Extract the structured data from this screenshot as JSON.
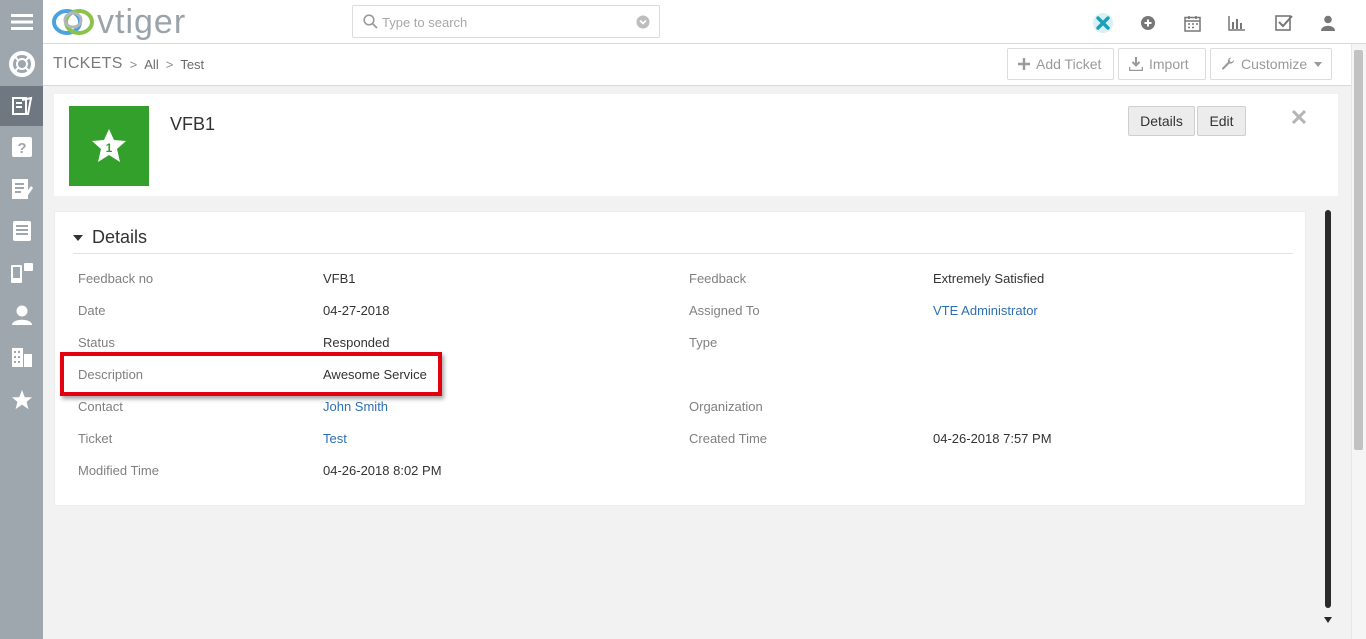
{
  "app": {
    "logo_text": "vtiger",
    "search_placeholder": "Type to search"
  },
  "breadcrumb": {
    "module": "TICKETS",
    "items": [
      "All",
      "Test"
    ]
  },
  "toolbar": {
    "add_label": "Add Ticket",
    "import_label": "Import",
    "customize_label": "Customize"
  },
  "record": {
    "title": "VFB1",
    "details_btn": "Details",
    "edit_btn": "Edit"
  },
  "section": {
    "title": "Details"
  },
  "fields": {
    "feedback_no": {
      "label": "Feedback no",
      "value": "VFB1"
    },
    "date": {
      "label": "Date",
      "value": "04-27-2018"
    },
    "status": {
      "label": "Status",
      "value": "Responded"
    },
    "description": {
      "label": "Description",
      "value": "Awesome Service"
    },
    "contact": {
      "label": "Contact",
      "value": "John Smith"
    },
    "ticket": {
      "label": "Ticket",
      "value": "Test"
    },
    "modified_time": {
      "label": "Modified Time",
      "value": "04-26-2018 8:02 PM"
    },
    "feedback": {
      "label": "Feedback",
      "value": "Extremely Satisfied"
    },
    "assigned_to": {
      "label": "Assigned To",
      "value": "VTE Administrator"
    },
    "type": {
      "label": "Type",
      "value": ""
    },
    "organization": {
      "label": "Organization",
      "value": ""
    },
    "created_time": {
      "label": "Created Time",
      "value": "04-26-2018 7:57 PM"
    }
  },
  "colors": {
    "sidebar_bg": "#9ea6ae",
    "record_icon_bg": "#33a02c",
    "link": "#2f6fb5",
    "highlight": "#e3000f"
  },
  "icons": {
    "sidebar": [
      "menu-icon",
      "support-lifebuoy-icon",
      "tickets-icon",
      "faq-icon",
      "notes-icon",
      "documents-icon",
      "messages-icon",
      "contacts-icon",
      "organizations-icon",
      "feedback-star-icon"
    ],
    "topbar": [
      "vte-x-icon",
      "add-circle-icon",
      "calendar-icon",
      "reports-chart-icon",
      "tasks-check-icon",
      "user-icon"
    ]
  }
}
